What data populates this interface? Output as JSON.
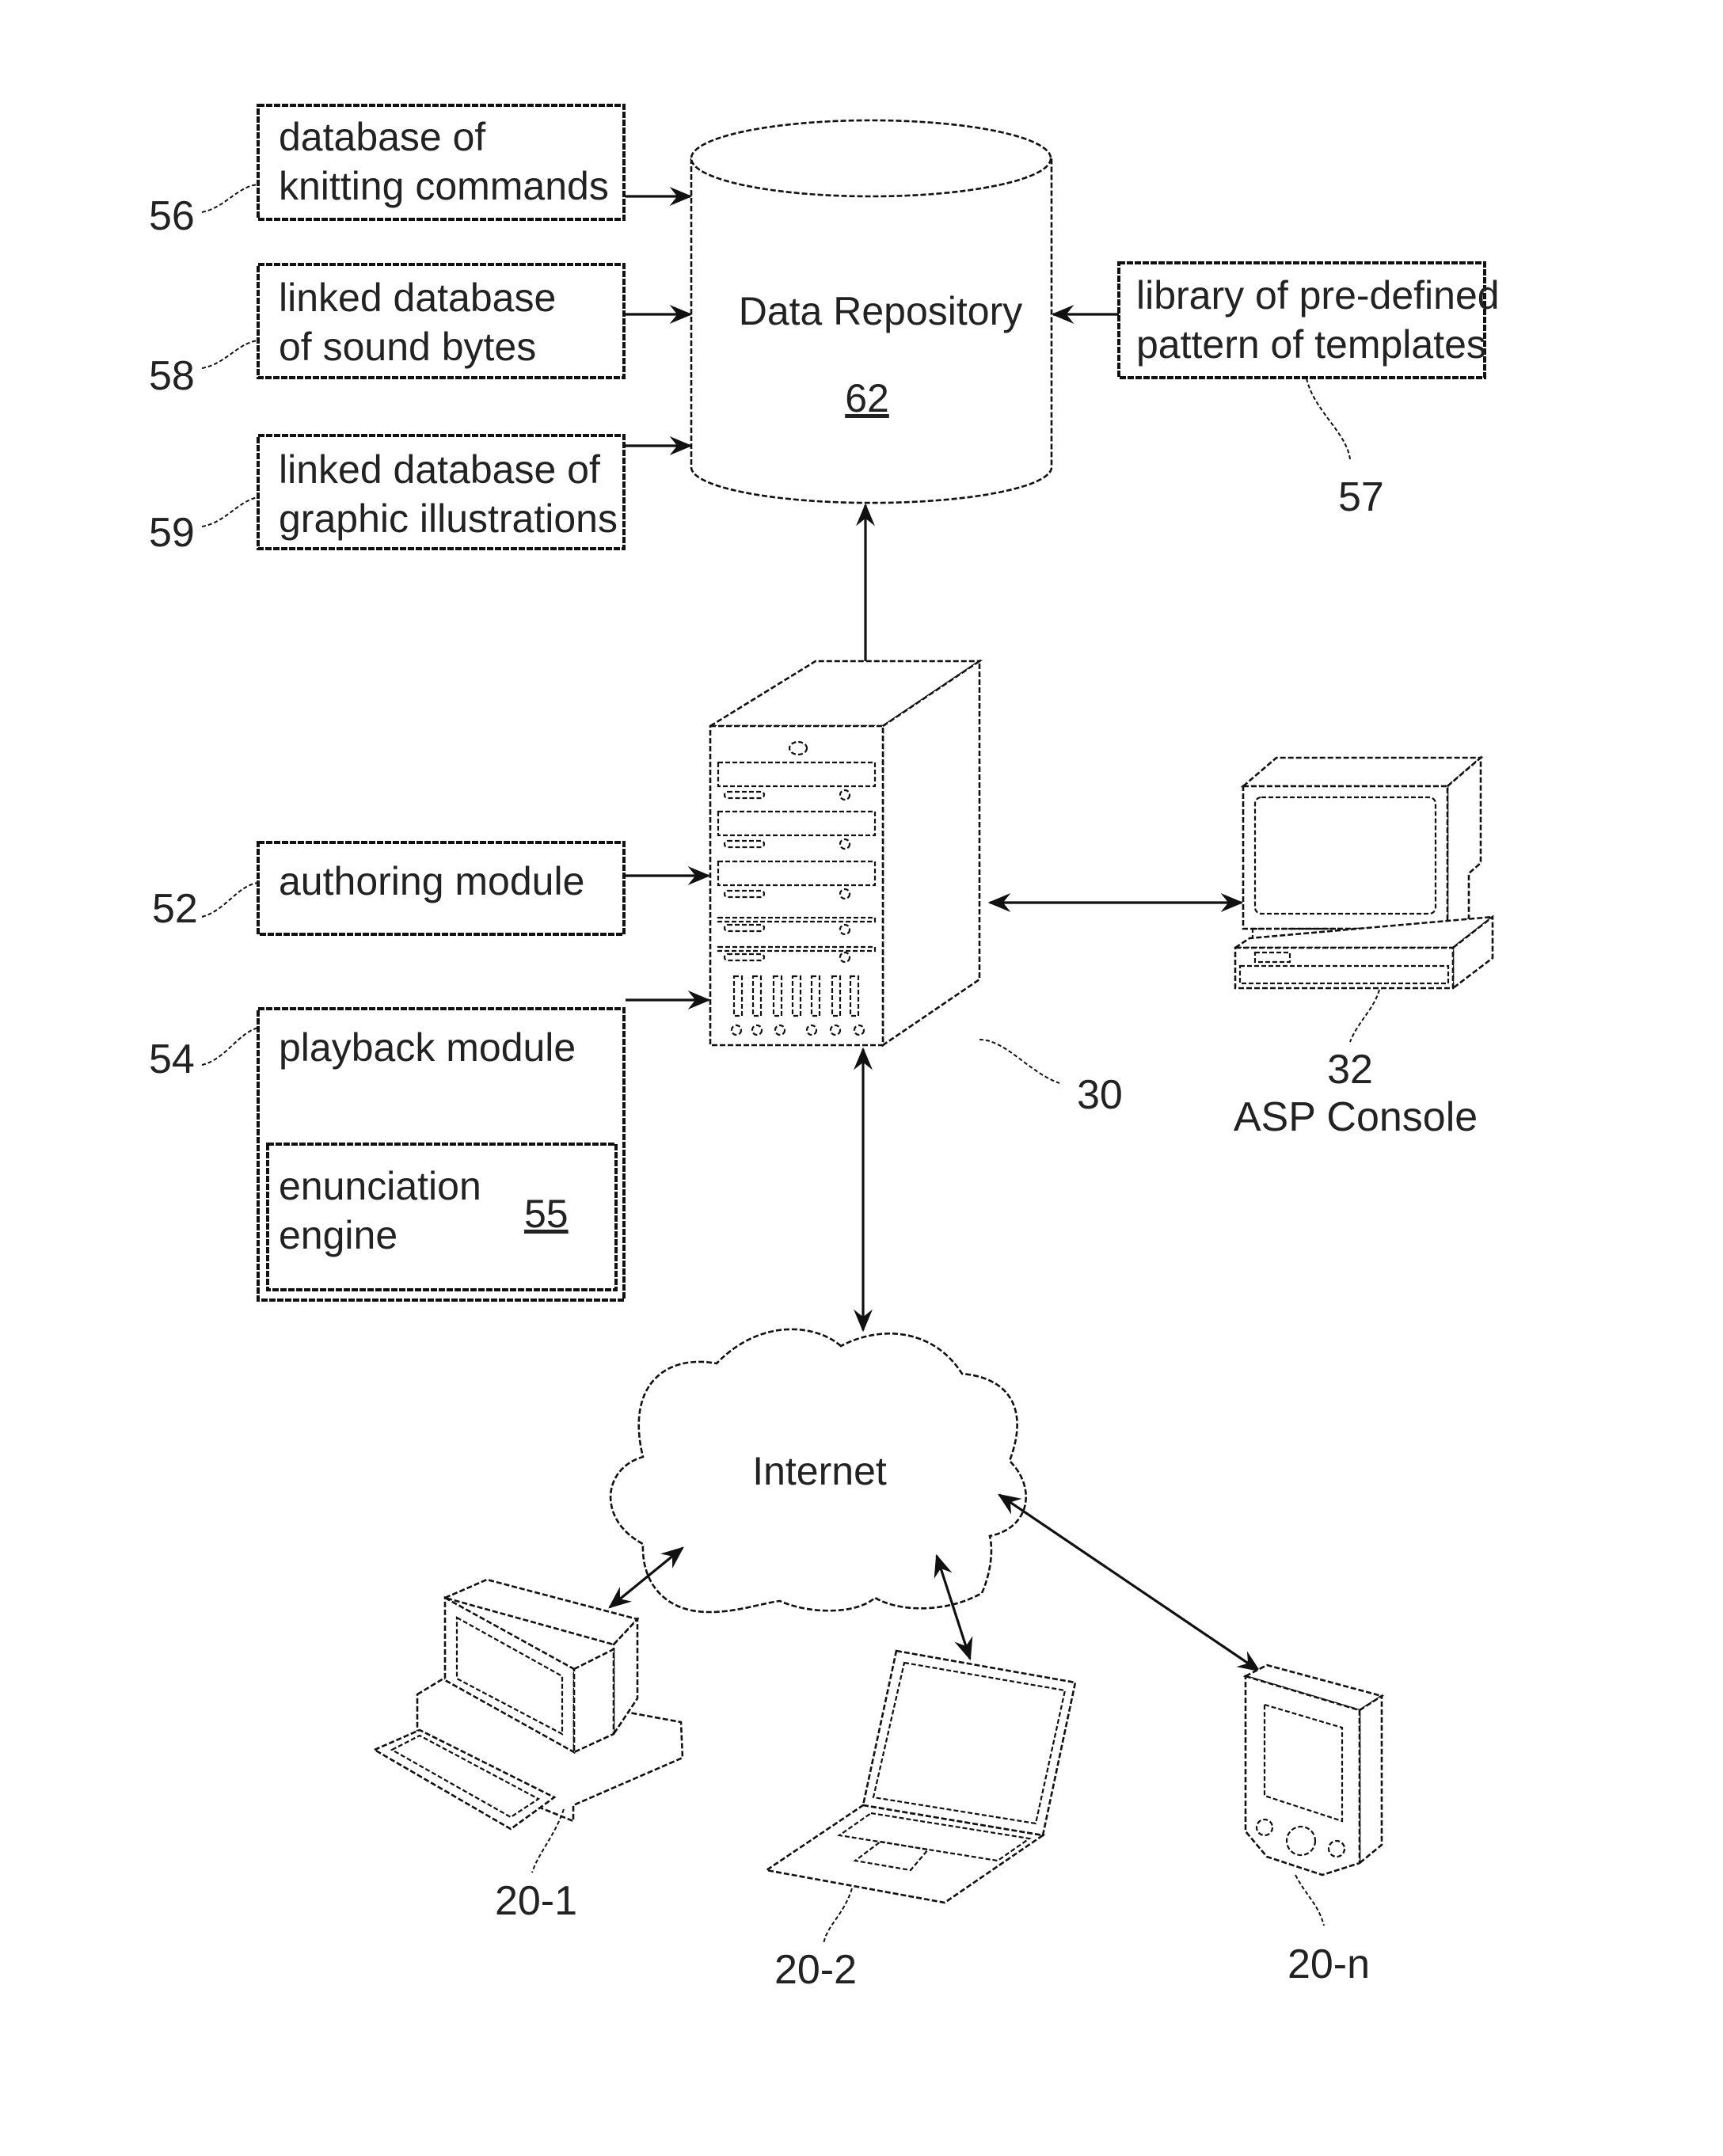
{
  "figure": {
    "type": "patent system block diagram",
    "nodes": {
      "data_repository": {
        "label": "Data Repository",
        "ref": "62"
      },
      "knitting_commands": {
        "lines": [
          "database of",
          "knitting commands"
        ],
        "ref": "56"
      },
      "sound_bytes": {
        "lines": [
          "linked database",
          "of sound bytes"
        ],
        "ref": "58"
      },
      "graphic_illustrations": {
        "lines": [
          "linked database of",
          "graphic illustrations"
        ],
        "ref": "59"
      },
      "templates_library": {
        "lines": [
          "library of pre-defined",
          "pattern of templates"
        ],
        "ref": "57"
      },
      "authoring_module": {
        "label": "authoring module",
        "ref": "52"
      },
      "playback_module": {
        "label": "playback module",
        "ref": "54"
      },
      "enunciation_engine": {
        "lines": [
          "enunciation",
          "engine"
        ],
        "ref": "55"
      },
      "server": {
        "ref": "30"
      },
      "asp_console": {
        "ref": "32",
        "label": "ASP Console"
      },
      "internet": {
        "label": "Internet"
      },
      "desktop_client": {
        "ref": "20-1"
      },
      "laptop_client": {
        "ref": "20-2"
      },
      "pda_client": {
        "ref": "20-n"
      }
    },
    "edges": [
      {
        "from": "56",
        "to": "62",
        "direction": "one-way"
      },
      {
        "from": "58",
        "to": "62",
        "direction": "one-way"
      },
      {
        "from": "59",
        "to": "62",
        "direction": "one-way"
      },
      {
        "from": "57",
        "to": "62",
        "direction": "one-way"
      },
      {
        "from": "30",
        "to": "62",
        "direction": "one-way"
      },
      {
        "from": "52",
        "to": "30",
        "direction": "one-way"
      },
      {
        "from": "54",
        "to": "30",
        "direction": "one-way"
      },
      {
        "from": "30",
        "to": "32",
        "direction": "two-way"
      },
      {
        "from": "30",
        "to": "Internet",
        "direction": "two-way"
      },
      {
        "from": "Internet",
        "to": "20-1",
        "direction": "two-way"
      },
      {
        "from": "Internet",
        "to": "20-2",
        "direction": "two-way"
      },
      {
        "from": "Internet",
        "to": "20-n",
        "direction": "two-way"
      }
    ]
  }
}
